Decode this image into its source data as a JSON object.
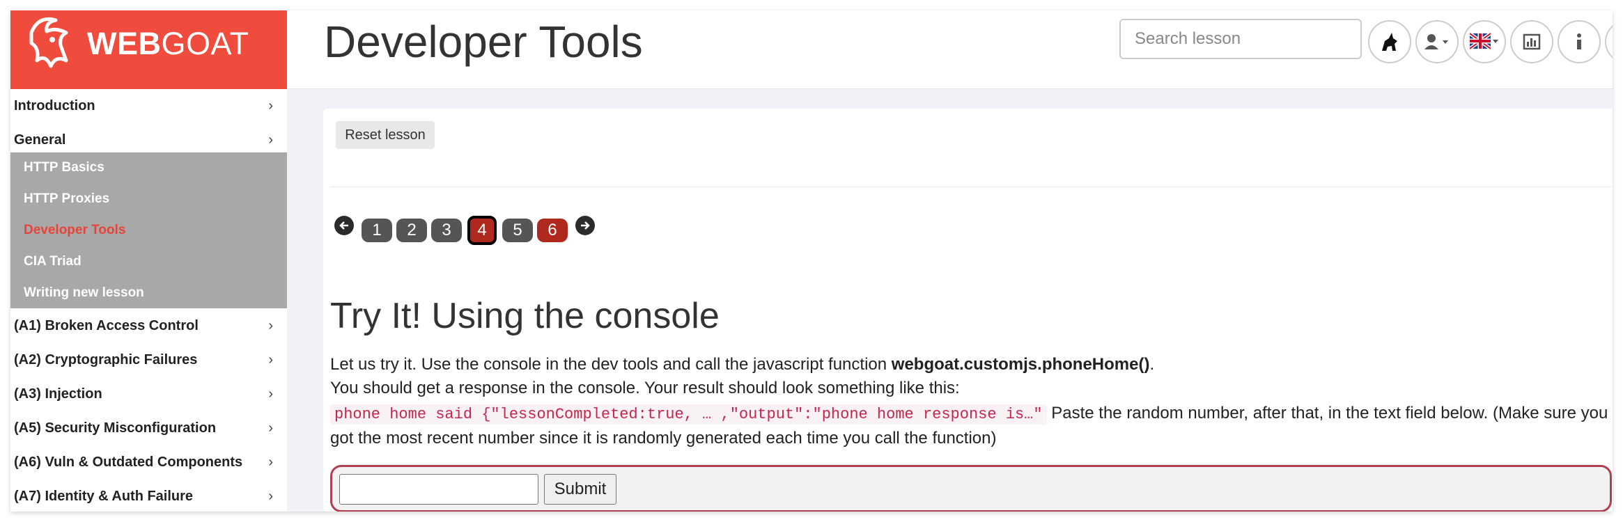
{
  "logo": {
    "web": "WEB",
    "goat": "GOAT"
  },
  "sidebar": {
    "top_categories": [
      {
        "label": "Introduction"
      },
      {
        "label": "General"
      }
    ],
    "general_items": [
      {
        "label": "HTTP Basics"
      },
      {
        "label": "HTTP Proxies"
      },
      {
        "label": "Developer Tools"
      },
      {
        "label": "CIA Triad"
      },
      {
        "label": "Writing new lesson"
      }
    ],
    "categories": [
      {
        "label": "(A1) Broken Access Control"
      },
      {
        "label": "(A2) Cryptographic Failures"
      },
      {
        "label": "(A3) Injection"
      },
      {
        "label": "(A5) Security Misconfiguration"
      },
      {
        "label": "(A6) Vuln & Outdated Components"
      },
      {
        "label": "(A7) Identity & Auth Failure"
      }
    ],
    "chevron": "›"
  },
  "header": {
    "title": "Developer Tools",
    "search_placeholder": "Search lesson",
    "buttons": [
      "wolf-icon",
      "user-icon",
      "uk-flag-icon",
      "chart-icon",
      "info-icon",
      "envelope-icon"
    ]
  },
  "lesson": {
    "reset_label": "Reset lesson",
    "pages": [
      {
        "label": "1",
        "state": "visited"
      },
      {
        "label": "2",
        "state": "visited"
      },
      {
        "label": "3",
        "state": "visited"
      },
      {
        "label": "4",
        "state": "current"
      },
      {
        "label": "5",
        "state": "visited"
      },
      {
        "label": "6",
        "state": "todo"
      }
    ],
    "section_title": "Try It! Using the console",
    "p1_before": "Let us try it. Use the console in the dev tools and call the javascript function ",
    "p1_bold": "webgoat.customjs.phoneHome()",
    "p1_after": ".",
    "p2": "You should get a response in the console. Your result should look something like this:",
    "code": "phone home said {\"lessonCompleted:true, … ,\"output\":\"phone home response is…\"",
    "p3": " Paste the random number, after that, in the text field below. (Make sure you got the most recent number since it is randomly generated each time you call the function)",
    "answer_value": "",
    "submit_label": "Submit"
  },
  "colors": {
    "brand": "#ef4c3e",
    "active_item": "#e8433a",
    "submenu_bg": "#a8a8a8",
    "page_red": "#b0291e"
  }
}
